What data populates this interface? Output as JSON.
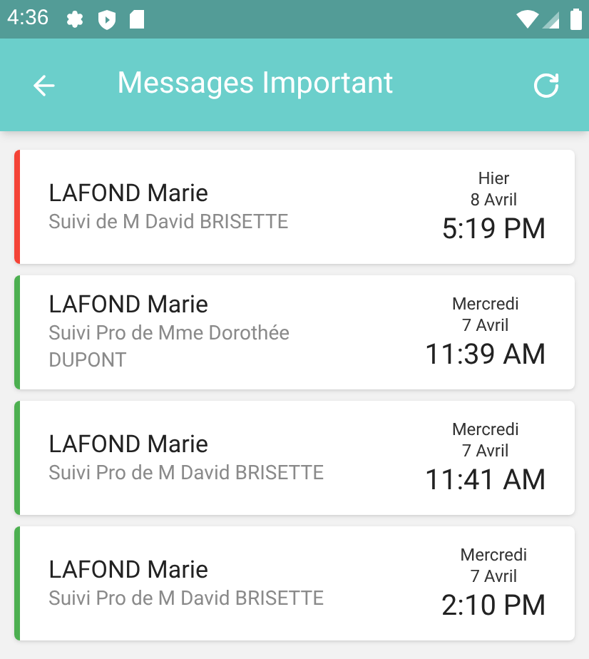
{
  "status_bar": {
    "time": "4:36"
  },
  "app_bar": {
    "title": "Messages Important"
  },
  "messages": [
    {
      "name": "LAFOND Marie",
      "subject": "Suivi de M David BRISETTE",
      "day": "Hier",
      "date": "8 Avril",
      "time": "5:19 PM",
      "color": "#f44336"
    },
    {
      "name": "LAFOND Marie",
      "subject": "Suivi Pro de Mme Dorothée DUPONT",
      "day": "Mercredi",
      "date": "7 Avril",
      "time": "11:39 AM",
      "color": "#4caf50"
    },
    {
      "name": "LAFOND Marie",
      "subject": "Suivi Pro de M David BRISETTE",
      "day": "Mercredi",
      "date": "7 Avril",
      "time": "11:41 AM",
      "color": "#4caf50"
    },
    {
      "name": "LAFOND Marie",
      "subject": "Suivi Pro de M David BRISETTE",
      "day": "Mercredi",
      "date": "7 Avril",
      "time": "2:10 PM",
      "color": "#4caf50"
    }
  ]
}
